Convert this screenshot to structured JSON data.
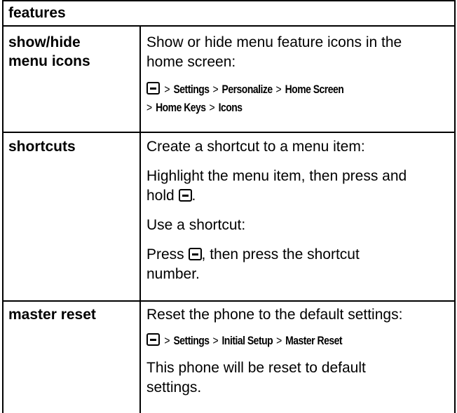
{
  "header": {
    "label": "features"
  },
  "rows": [
    {
      "feature": [
        "show/hide",
        "menu icons"
      ],
      "desc1": [
        "Show or hide menu feature icons in the",
        "home screen:"
      ],
      "path_line1": [
        "Settings",
        "Personalize",
        "Home Screen"
      ],
      "path_line2": [
        "Home Keys",
        "Icons"
      ]
    },
    {
      "feature": [
        "shortcuts"
      ],
      "desc1": "Create a shortcut to a menu item:",
      "desc2a": "Highlight the menu item, then press and",
      "desc2b": "hold",
      "desc2b_end": ".",
      "desc3": "Use a shortcut:",
      "desc4a": "Press",
      "desc4a_end": ", then press the shortcut",
      "desc4b": "number."
    },
    {
      "feature": [
        "master reset"
      ],
      "desc1": "Reset the phone to the default settings:",
      "path": [
        "Settings",
        "Initial Setup",
        "Master Reset"
      ],
      "desc3": [
        "This phone will be reset to default",
        "settings."
      ]
    }
  ],
  "separator": ">",
  "icons": {
    "menu_key": "menu-key-icon"
  }
}
